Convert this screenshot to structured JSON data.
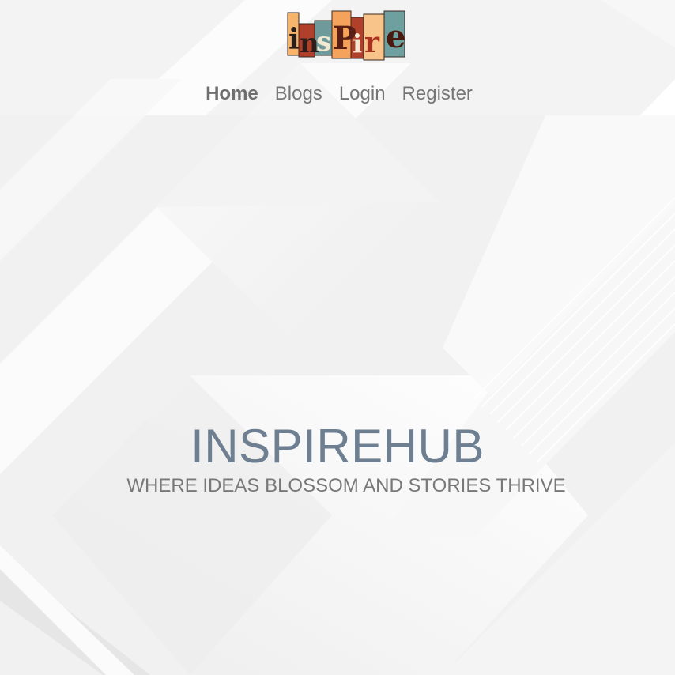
{
  "brand": {
    "logo_text": "inspire",
    "logo_colors": [
      "#a8321e",
      "#f5a35c",
      "#2e2a2a",
      "#5d8c8e",
      "#e07a2a",
      "#5a1f14"
    ]
  },
  "nav": {
    "items": [
      {
        "label": "Home",
        "active": true
      },
      {
        "label": "Blogs",
        "active": false
      },
      {
        "label": "Login",
        "active": false
      },
      {
        "label": "Register",
        "active": false
      }
    ]
  },
  "hero": {
    "title": "INSPIREHUB",
    "subtitle": "WHERE IDEAS BLOSSOM AND STORIES THRIVE"
  },
  "colors": {
    "background": "#f2f2f2",
    "title": "#6e7f91",
    "nav_text": "#757575"
  }
}
